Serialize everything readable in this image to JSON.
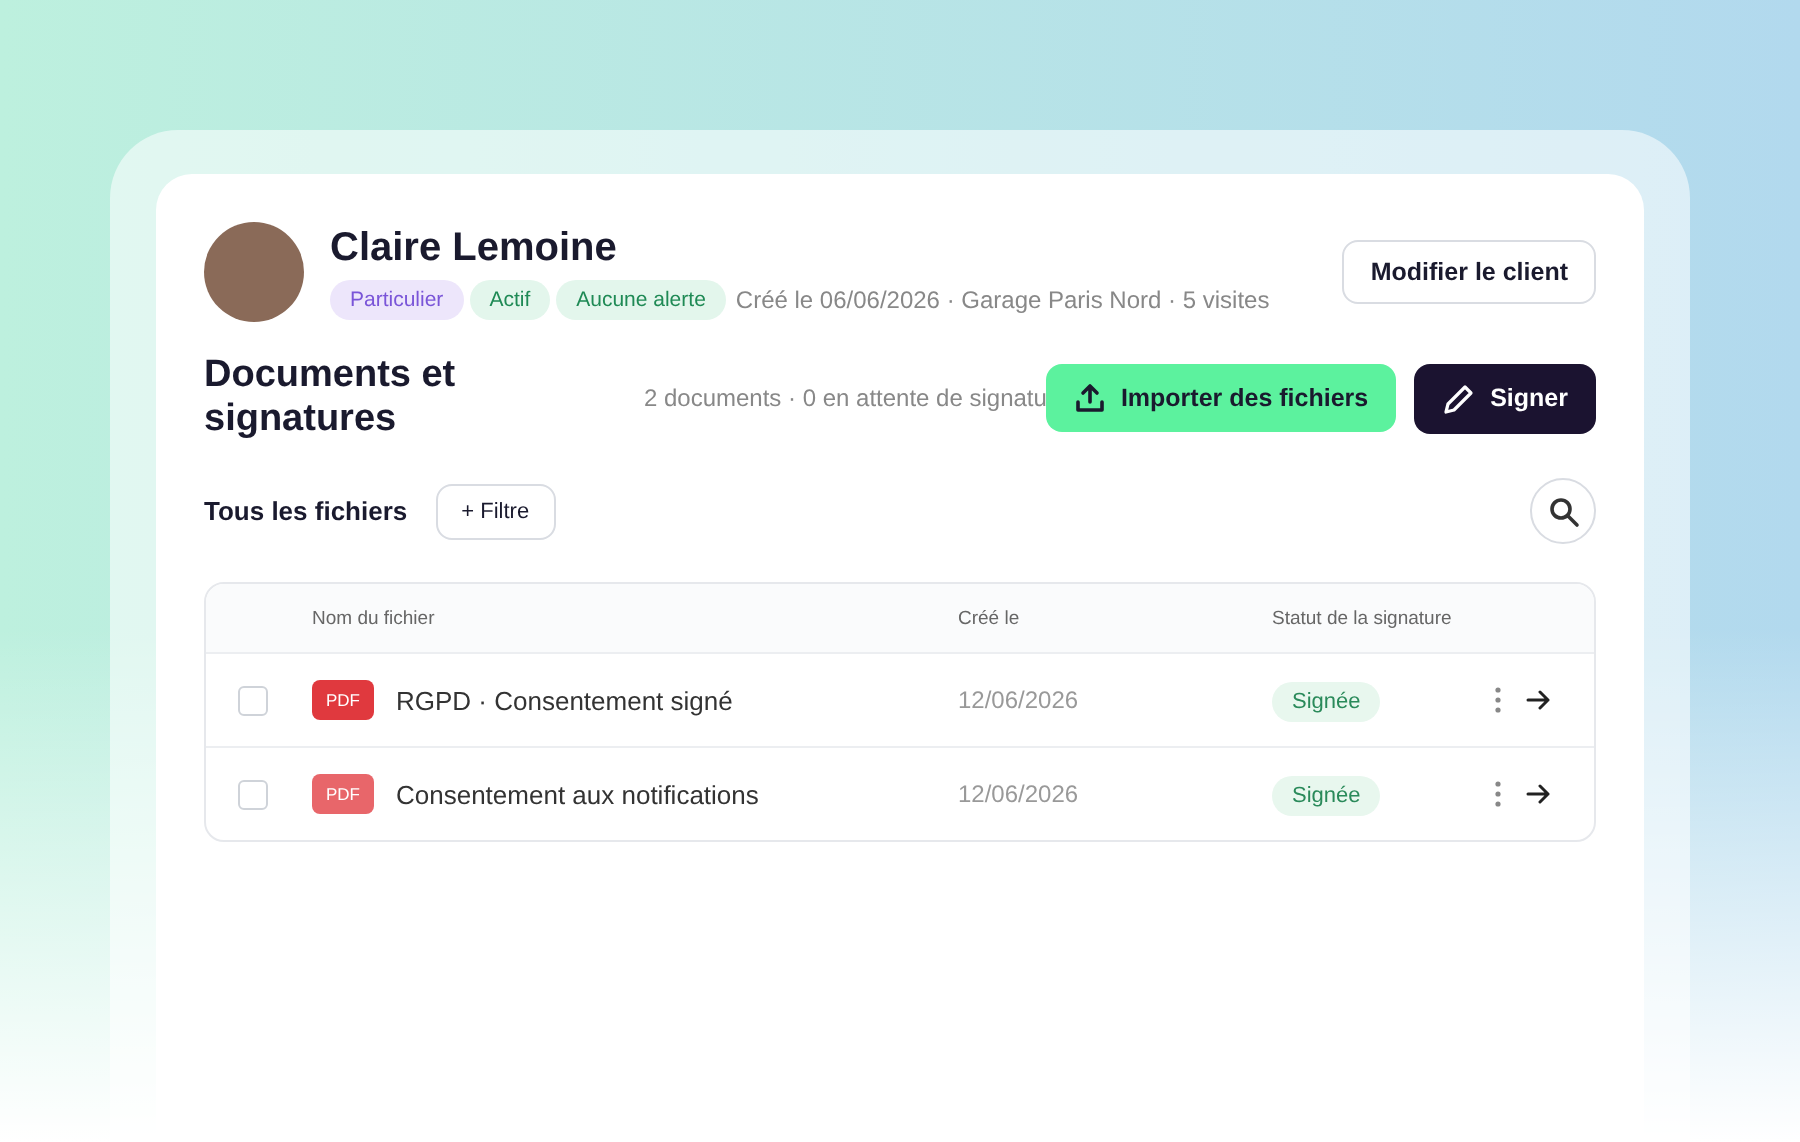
{
  "client": {
    "name": "Claire Lemoine",
    "tags": [
      {
        "label": "Particulier",
        "color": "#ede6fb"
      },
      {
        "label": "Actif",
        "color": "#e3f6ec"
      },
      {
        "label": "Aucune alerte",
        "color": "#e3f6ec"
      }
    ],
    "meta": "Créé le 06/06/2026 · Garage Paris Nord · 5 visites",
    "edit_button": "Modifier le client"
  },
  "documents": {
    "title": "Documents et signatures",
    "summary": "2 documents · 0 en attente de signatu",
    "import_button": "Importer des fichiers",
    "sign_button": "Signer"
  },
  "filters": {
    "label": "Tous les fichiers",
    "filter_button": "+ Filtre"
  },
  "table": {
    "columns": [
      "Nom du fichier",
      "Créé le",
      "Statut de la signature"
    ],
    "rows": [
      {
        "checked": false,
        "badge": "PDF",
        "color": "#e0393e",
        "name": "RGPD · Consentement signé",
        "date": "12/06/2026",
        "status": "Signée"
      },
      {
        "checked": false,
        "badge": "PDF",
        "color": "#e8666a",
        "name": "Consentement aux notifications",
        "date": "12/06/2026",
        "status": "Signée"
      }
    ]
  }
}
